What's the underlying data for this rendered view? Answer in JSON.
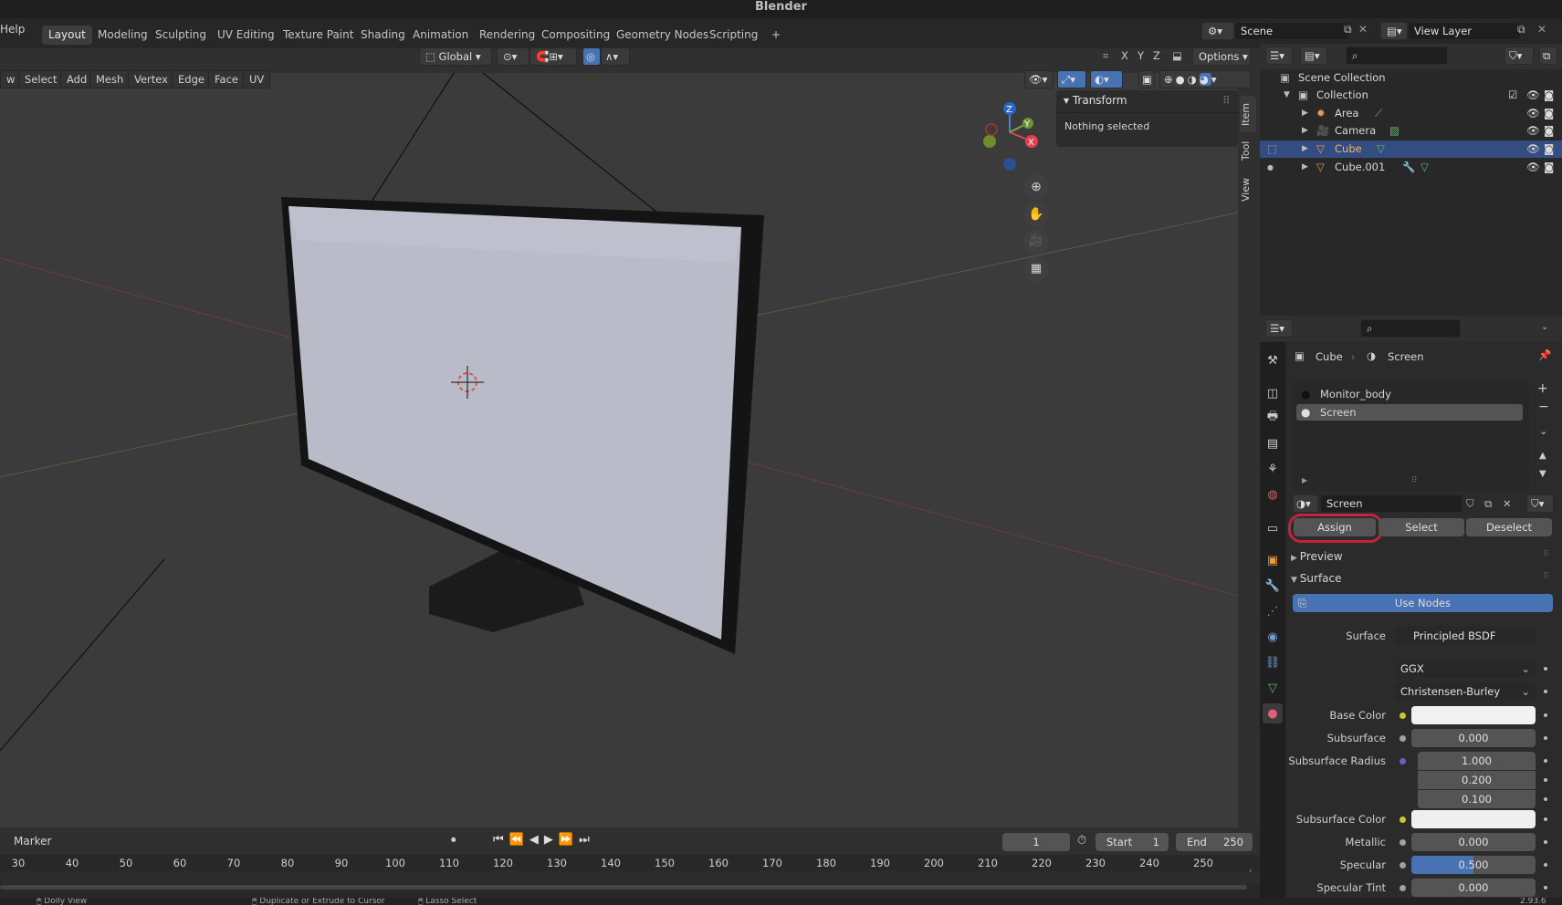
{
  "window": {
    "title": "Blender"
  },
  "menu": {
    "help": "Help"
  },
  "workspaces": [
    "Layout",
    "Modeling",
    "Sculpting",
    "UV Editing",
    "Texture Paint",
    "Shading",
    "Animation",
    "Rendering",
    "Compositing",
    "Geometry Nodes",
    "Scripting"
  ],
  "workspace_add": "+",
  "scene": {
    "name": "Scene",
    "view_layer": "View Layer"
  },
  "viewport_header": {
    "transform_orientation": "Global",
    "axis_x": "X",
    "axis_y": "Y",
    "axis_z": "Z",
    "options": "Options"
  },
  "edit_menu": [
    "w",
    "Select",
    "Add",
    "Mesh",
    "Vertex",
    "Edge",
    "Face",
    "UV"
  ],
  "n_panel": {
    "section": "Transform",
    "message": "Nothing selected",
    "tabs": [
      "Item",
      "Tool",
      "View"
    ]
  },
  "outliner": {
    "root": "Scene Collection",
    "collection": "Collection",
    "items": [
      {
        "name": "Area",
        "icon": "light-icon",
        "color": "#e89a5c"
      },
      {
        "name": "Camera",
        "icon": "camera-icon",
        "color": "#e89a5c"
      },
      {
        "name": "Cube",
        "icon": "mesh-icon",
        "color": "#ff9c3c",
        "selected": true
      },
      {
        "name": "Cube.001",
        "icon": "mesh-icon",
        "color": "#e89a5c"
      }
    ]
  },
  "properties": {
    "breadcrumb_object": "Cube",
    "breadcrumb_material": "Screen",
    "material_slots": [
      "Monitor_body",
      "Screen"
    ],
    "active_slot": "Screen",
    "material_name": "Screen",
    "buttons": {
      "assign": "Assign",
      "select": "Select",
      "deselect": "Deselect"
    },
    "preview": "Preview",
    "surface_section": "Surface",
    "use_nodes": "Use Nodes",
    "surface_label": "Surface",
    "surface_value": "Principled BSDF",
    "distribution": "GGX",
    "subsurface_method": "Christensen-Burley",
    "fields": {
      "base_color": "Base Color",
      "subsurface": "Subsurface",
      "subsurface_value": "0.000",
      "subsurface_radius": "Subsurface Radius",
      "radius_values": [
        "1.000",
        "0.200",
        "0.100"
      ],
      "subsurface_color": "Subsurface Color",
      "metallic": "Metallic",
      "metallic_value": "0.000",
      "specular": "Specular",
      "specular_value": "0.500",
      "specular_fraction": 0.5,
      "specular_tint": "Specular Tint",
      "specular_tint_value": "0.000"
    },
    "colors": {
      "base_color": "#f2f2f2",
      "subsurface_color": "#efefef",
      "accent": "#4772b3"
    }
  },
  "timeline": {
    "marker": "Marker",
    "current_frame": "1",
    "start_label": "Start",
    "start_value": "1",
    "end_label": "End",
    "end_value": "250",
    "ticks": [
      "30",
      "40",
      "50",
      "60",
      "70",
      "80",
      "90",
      "100",
      "110",
      "120",
      "130",
      "140",
      "150",
      "160",
      "170",
      "180",
      "190",
      "200",
      "210",
      "220",
      "230",
      "240",
      "250"
    ]
  },
  "status": {
    "left": "Dolly View",
    "middle": "Duplicate or Extrude to Cursor",
    "right": "Lasso Select",
    "version": "2.93.6"
  }
}
